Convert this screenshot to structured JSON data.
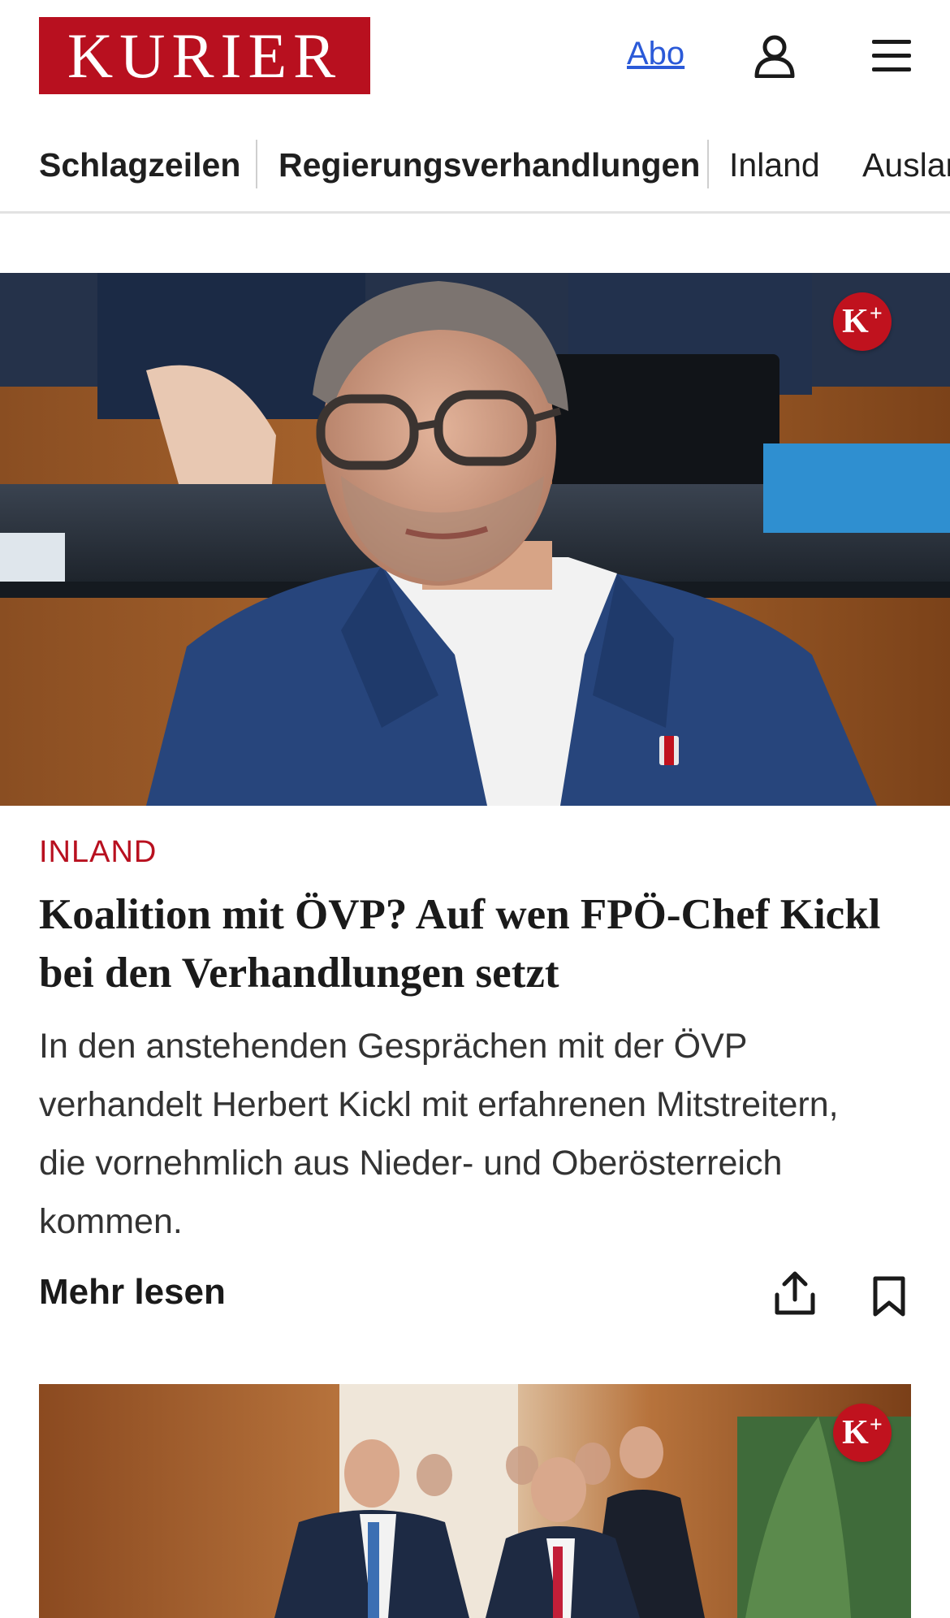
{
  "header": {
    "logo_text": "KURIER",
    "abo_label": "Abo",
    "user_icon": "user-icon",
    "menu_icon": "hamburger-menu-icon"
  },
  "nav": {
    "items": [
      {
        "label": "Schlagzeilen",
        "bold": true
      },
      {
        "label": "Regierungsverhandlungen",
        "bold": true
      },
      {
        "label": "Inland",
        "bold": false
      },
      {
        "label": "Ausland",
        "bold": false
      }
    ]
  },
  "articles": [
    {
      "badge": "K+",
      "category": "INLAND",
      "headline": "Koalition mit ÖVP? Auf wen FPÖ-Chef Kickl bei den Verhandlungen setzt",
      "teaser": "In den anstehenden Gesprächen mit der ÖVP verhandelt Herbert Kickl mit erfahrenen Mitstreitern, die vornehmlich aus Nieder- und Oberösterreich kommen.",
      "more_label": "Mehr lesen",
      "share_icon": "share-icon",
      "bookmark_icon": "bookmark-icon"
    },
    {
      "badge": "K+"
    }
  ],
  "colors": {
    "brand_red": "#b8101f",
    "link_blue": "#2b5ad8",
    "badge_red": "#c0121e"
  }
}
